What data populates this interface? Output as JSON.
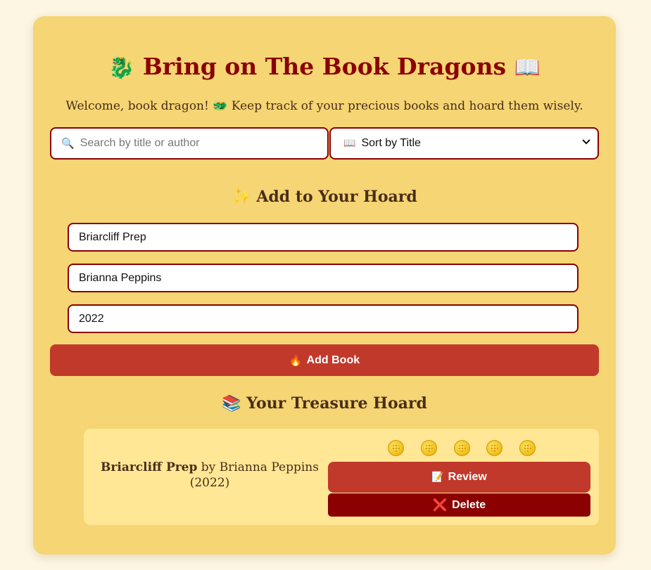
{
  "header": {
    "title": "Bring on The Book Dragons",
    "title_left_icon": "🐉",
    "title_right_icon": "📖",
    "subtitle_before": "Welcome, book dragon!",
    "subtitle_icon": "🐲",
    "subtitle_after": "Keep track of your precious books and hoard them wisely."
  },
  "controls": {
    "search_icon": "🔍",
    "search_placeholder": "Search by title or author",
    "search_value": "",
    "sort_icon": "📖",
    "sort_selected": "Sort by Title"
  },
  "add_section": {
    "heading_icon": "✨",
    "heading": "Add to Your Hoard",
    "title_value": "Briarcliff Prep",
    "author_value": "Brianna Peppins",
    "year_value": "2022",
    "button_icon": "🔥",
    "button_label": "Add Book"
  },
  "hoard": {
    "heading_icon": "📚",
    "heading": "Your Treasure Hoard",
    "books": [
      {
        "title": "Briarcliff Prep",
        "by": "by",
        "author": "Brianna Peppins",
        "year": "(2022)",
        "rating": 5,
        "review_icon": "📝",
        "review_label": "Review",
        "delete_icon": "❌",
        "delete_label": "Delete"
      }
    ]
  },
  "colors": {
    "page_bg": "#fdf6e3",
    "card_bg": "#f5d574",
    "accent_dark_red": "#8b0000",
    "button_red": "#c0392b",
    "book_card_bg": "#ffe795",
    "text_brown": "#4a2e1a"
  }
}
